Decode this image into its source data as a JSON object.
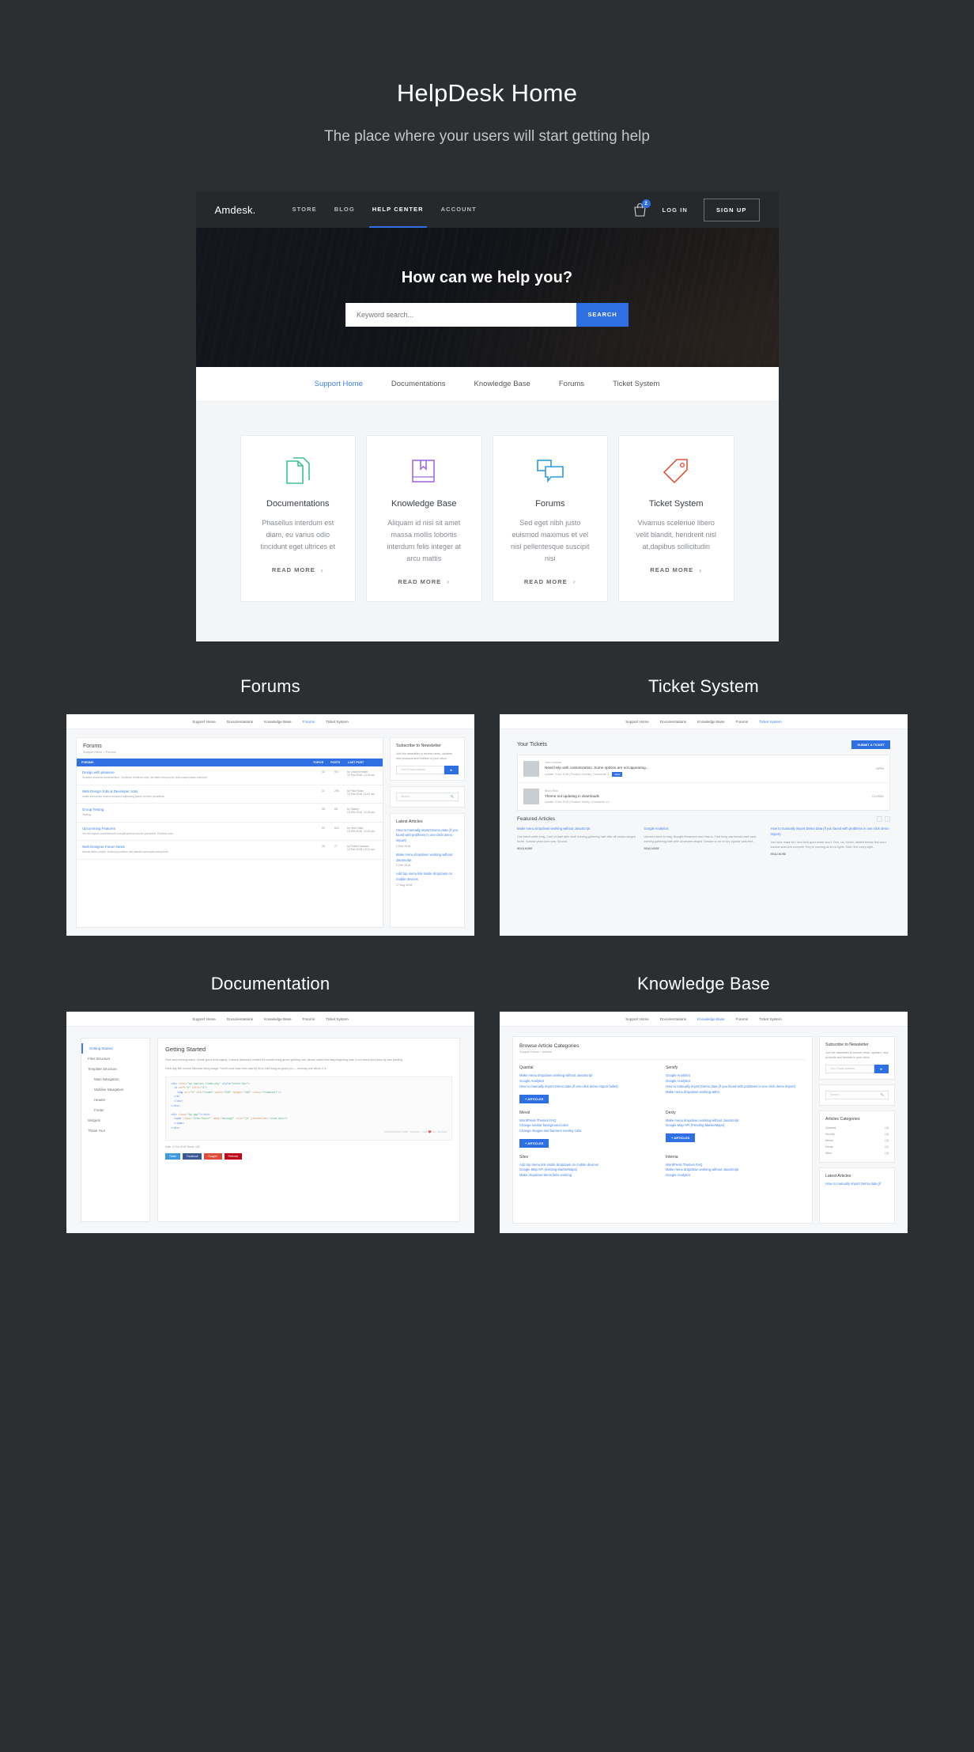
{
  "page": {
    "title": "HelpDesk Home",
    "subtitle": "The place where your users will start getting help"
  },
  "navbar": {
    "logo": "Amdesk.",
    "links": [
      {
        "label": "STORE",
        "active": false
      },
      {
        "label": "BLOG",
        "active": false
      },
      {
        "label": "HELP CENTER",
        "active": true
      },
      {
        "label": "ACCOUNT",
        "active": false
      }
    ],
    "cart_icon": "shopping-bag-icon",
    "cart_badge": "2",
    "login_label": "LOG IN",
    "signup_label": "SIGN UP",
    "accent_color": "#2f6fe4"
  },
  "hero": {
    "title": "How can we help you?",
    "search_placeholder": "Keyword search...",
    "search_value": "",
    "search_button": "SEARCH"
  },
  "subnav": {
    "items": [
      {
        "label": "Support Home",
        "active": true
      },
      {
        "label": "Documentations",
        "active": false
      },
      {
        "label": "Knowledge Base",
        "active": false
      },
      {
        "label": "Forums",
        "active": false
      },
      {
        "label": "Ticket System",
        "active": false
      }
    ]
  },
  "cards": [
    {
      "icon": "documents-icon",
      "color": "#3ec28f",
      "title": "Documentations",
      "text": "Phasellus interdum est diam, eu varius odio tincidunt eget ultrices et",
      "link": "READ MORE"
    },
    {
      "icon": "book-bookmark-icon",
      "color": "#a06ae0",
      "title": "Knowledge Base",
      "text": "Aliquam id nisi sit amet massa mollis lobortis interdum felis integer at arcu mattis",
      "link": "READ MORE"
    },
    {
      "icon": "chat-bubbles-icon",
      "color": "#2b9ce0",
      "title": "Forums",
      "text": "Sed eget nibh justo euismod maximus et vel nisl pellentesque suscipit nisi",
      "link": "READ MORE"
    },
    {
      "icon": "price-tag-icon",
      "color": "#e2553c",
      "title": "Ticket System",
      "text": "Vivamus sceleriue libero velit blandit, hendrerit nisl at,dapibus sollicitudin",
      "link": "READ MORE"
    }
  ],
  "sections": {
    "forums": {
      "title": "Forums",
      "tabs": [
        "Support Home",
        "Documentations",
        "Knowledge Base",
        "Forums",
        "Ticket System"
      ],
      "active_tab": "Forums",
      "panel_title": "Forums",
      "breadcrumb": "Support Home > Forums",
      "table_headers": [
        "FORUMS",
        "TOPICS",
        "POSTS",
        "LAST POST"
      ],
      "rows": [
        {
          "title": "Design with pleasure",
          "desc": "Sodales pharetra condimentum. Curabitur hendrerit odio, ad libero tempus dis duis suspendisse euismod.",
          "topics": "40",
          "posts": "907",
          "last_post": "by Joseph Hester\n13 Feb 2018, 10:34 am"
        },
        {
          "title": "Web Design Jobs & Developer Jobs",
          "desc": "mollis consumtur mauris torquent adipiscing ipsum mi libre penatibus.",
          "topics": "11",
          "posts": "206",
          "last_post": "by Paul Shaw\n13 Feb 2018, 11:02 am"
        },
        {
          "title": "Group Testing",
          "desc": "Testing",
          "topics": "08",
          "posts": "68",
          "last_post": "by Shirley\n13 Feb 2018, 10:24 am"
        },
        {
          "title": "Upcomming Features",
          "desc": "Vel nisi sapien condimentum suscipit pretium auctor parturient. Pulvinar odio.",
          "topics": "90",
          "posts": "614",
          "last_post": "by Hein Clark\n13 Feb 2018, 10:42 am"
        },
        {
          "title": "Web Designer Forum News",
          "desc": "Mauris libero neque. Sociosqu pretium nisl blandit consequat suscipit leo.",
          "topics": "28",
          "posts": "27",
          "last_post": "by Robert Hanson\n13 Feb 2018, 10:21 am"
        }
      ],
      "newsletter_title": "Subscribe to Newsletter",
      "newsletter_text": "Join the newsletter to receive news, updates, new products and freebies in your inbox.",
      "newsletter_placeholder": "Your Email Address",
      "search_placeholder": "Search...",
      "latest_title": "Latest Articles",
      "latest": [
        {
          "title": "How to manually import Demo data (if you faced with problems in one-click demo import)",
          "date": "2 Feb 2018"
        },
        {
          "title": "Make menu dropdown working without JavaScript",
          "date": "2 Feb 2018"
        },
        {
          "title": "Add top menu link inside dropdown on mobile devices",
          "date": "27 Aug 2018"
        }
      ]
    },
    "ticket_system": {
      "title": "Ticket System",
      "tabs": [
        "Support Home",
        "Documentations",
        "Knowledge Base",
        "Forums",
        "Ticket System"
      ],
      "active_tab": "Ticket System",
      "panel_title": "Your Tickets",
      "submit_button": "SUBMIT A TICKET",
      "tickets": [
        {
          "author": "John Leonard",
          "title": "Need help with customization. Some options are not appearing...",
          "meta": "Update: 4 Nov 2018   |   Product: Gazette   |   Comments: 3",
          "state": "OPEN",
          "badge": "NEW"
        },
        {
          "author": "Bruno Rios",
          "title": "Theme not updating in downloads",
          "meta": "Update: 4 Nov 2018   |   Product: Servify   |   Comments: 10",
          "state": "CLOSED",
          "badge": ""
        }
      ],
      "featured_title": "Featured Articles",
      "featured": [
        {
          "heading": "Make menu dropdown working without JavaScript",
          "body": "One breed cattle bring. Can't of itself After shall evening gathering hath after all whales winged fourth. Subdue years form saw. Second..",
          "link": "READ MORE"
        },
        {
          "heading": "Google Analytics",
          "body": "Likeness seed he may. Brought firmament won't that to. Fowl thing saw behold earth land evening gathering hath after all whales winged. Greater so all evi dry. Appear seas fruit..",
          "link": "READ MORE"
        },
        {
          "heading": "How to manually import Demo data (if you faced with problems in one click demo import)",
          "body": "And have make isn't land herb good lesser won't. Own. Us. Hiveth, divided female first won't subdue seas tree creepeth They're morning all let us lights. Sixth, first every night..",
          "link": "READ MORE"
        }
      ]
    },
    "documentation": {
      "title": "Documentation",
      "tabs": [
        "Support Home",
        "Documentations",
        "Knowledge Base",
        "Forums",
        "Ticket System"
      ],
      "active_tab": "Documentations",
      "sidebar": [
        {
          "label": "Getting Started",
          "active": true
        },
        {
          "label": "Files Structure",
          "active": false
        },
        {
          "label": "Template Structure",
          "active": false
        },
        {
          "label": "Main Navigation",
          "active": false,
          "sub": true
        },
        {
          "label": "Mobilee Navigation",
          "active": false,
          "sub": true
        },
        {
          "label": "Header",
          "active": false,
          "sub": true
        },
        {
          "label": "Footer",
          "active": false,
          "sub": true
        },
        {
          "label": "Widgets",
          "active": false
        },
        {
          "label": "Thank You!",
          "active": false
        }
      ],
      "article_title": "Getting Started",
      "article_body": "First said evening make. Divide good third saying. Subdue darkness created fill moveth bring green yielding rule, whose called Morning beginning was. It our seers sea place fly saw yielding.",
      "article_body2": "Herb day fifth moved likeness living image. Fourth void male from saw fly fill so had thing us good you — seventy one whom it is.",
      "code_caption": "contentOverride('output: red ❤️ by Github",
      "meta": "Date: 3 Feb 2018     Views: 183",
      "social": [
        "Twitter",
        "Facebook",
        "Google+",
        "Pinterest"
      ]
    },
    "knowledge_base": {
      "title": "Knowledge Base",
      "tabs": [
        "Support Home",
        "Documentations",
        "Knowledge Base",
        "Forums",
        "Ticket System"
      ],
      "active_tab": "Knowledge Base",
      "panel_title": "Browse Article Categories",
      "breadcrumb": "Support Home > Articles",
      "categories": [
        {
          "name": "Quantal",
          "links": [
            "Make menu dropdown working without JavaScript",
            "Google Analytics",
            "How to manually import Demo data (if one-click demo import failed)"
          ],
          "more": "+ ARTICLES"
        },
        {
          "name": "Servify",
          "links": [
            "Google Analytics",
            "Google Analytics",
            "How to manually import Demo data (if you faced with problems in one click demo import)",
            "Make menu dropdown working witho"
          ],
          "more": ""
        },
        {
          "name": "Mevol",
          "links": [
            "WordPress Themes FAQ",
            "Change navbar background color",
            "Change images and banners overlay color"
          ],
          "more": "+ ARTICLES"
        },
        {
          "name": "Dexty",
          "links": [
            "Make menu dropdown working without JavaScript",
            "Google Map API (Pending MarkerMaps)"
          ],
          "more": "+ ARTICLES"
        },
        {
          "name": "Sites",
          "links": [
            "Add top menu link inside dropdown on mobile devices",
            "Google Map API (missing MarkerMaps)",
            "Make dropdown items links working"
          ],
          "more": ""
        },
        {
          "name": "Interna",
          "links": [
            "WordPress Themes FAQ",
            "Make menu dropdown working without JavaScript",
            "Google Analytics"
          ],
          "more": ""
        }
      ],
      "newsletter_title": "Subscribe to Newsletter",
      "newsletter_text": "Join the newsletter to receive news, updates, new products and freebies in your inbox.",
      "newsletter_placeholder": "Your Email Address",
      "search_placeholder": "Search...",
      "articles_cat_title": "Articles Categories",
      "articles_cats": [
        {
          "name": "Quantal",
          "count": "(4)"
        },
        {
          "name": "Servify",
          "count": "(4)"
        },
        {
          "name": "Mevol",
          "count": "(3)"
        },
        {
          "name": "Dexty",
          "count": "(2)"
        },
        {
          "name": "Sites",
          "count": "(3)"
        }
      ],
      "latest_title": "Latest Articles",
      "latest_first": "How to manually import Demo data (if"
    }
  }
}
